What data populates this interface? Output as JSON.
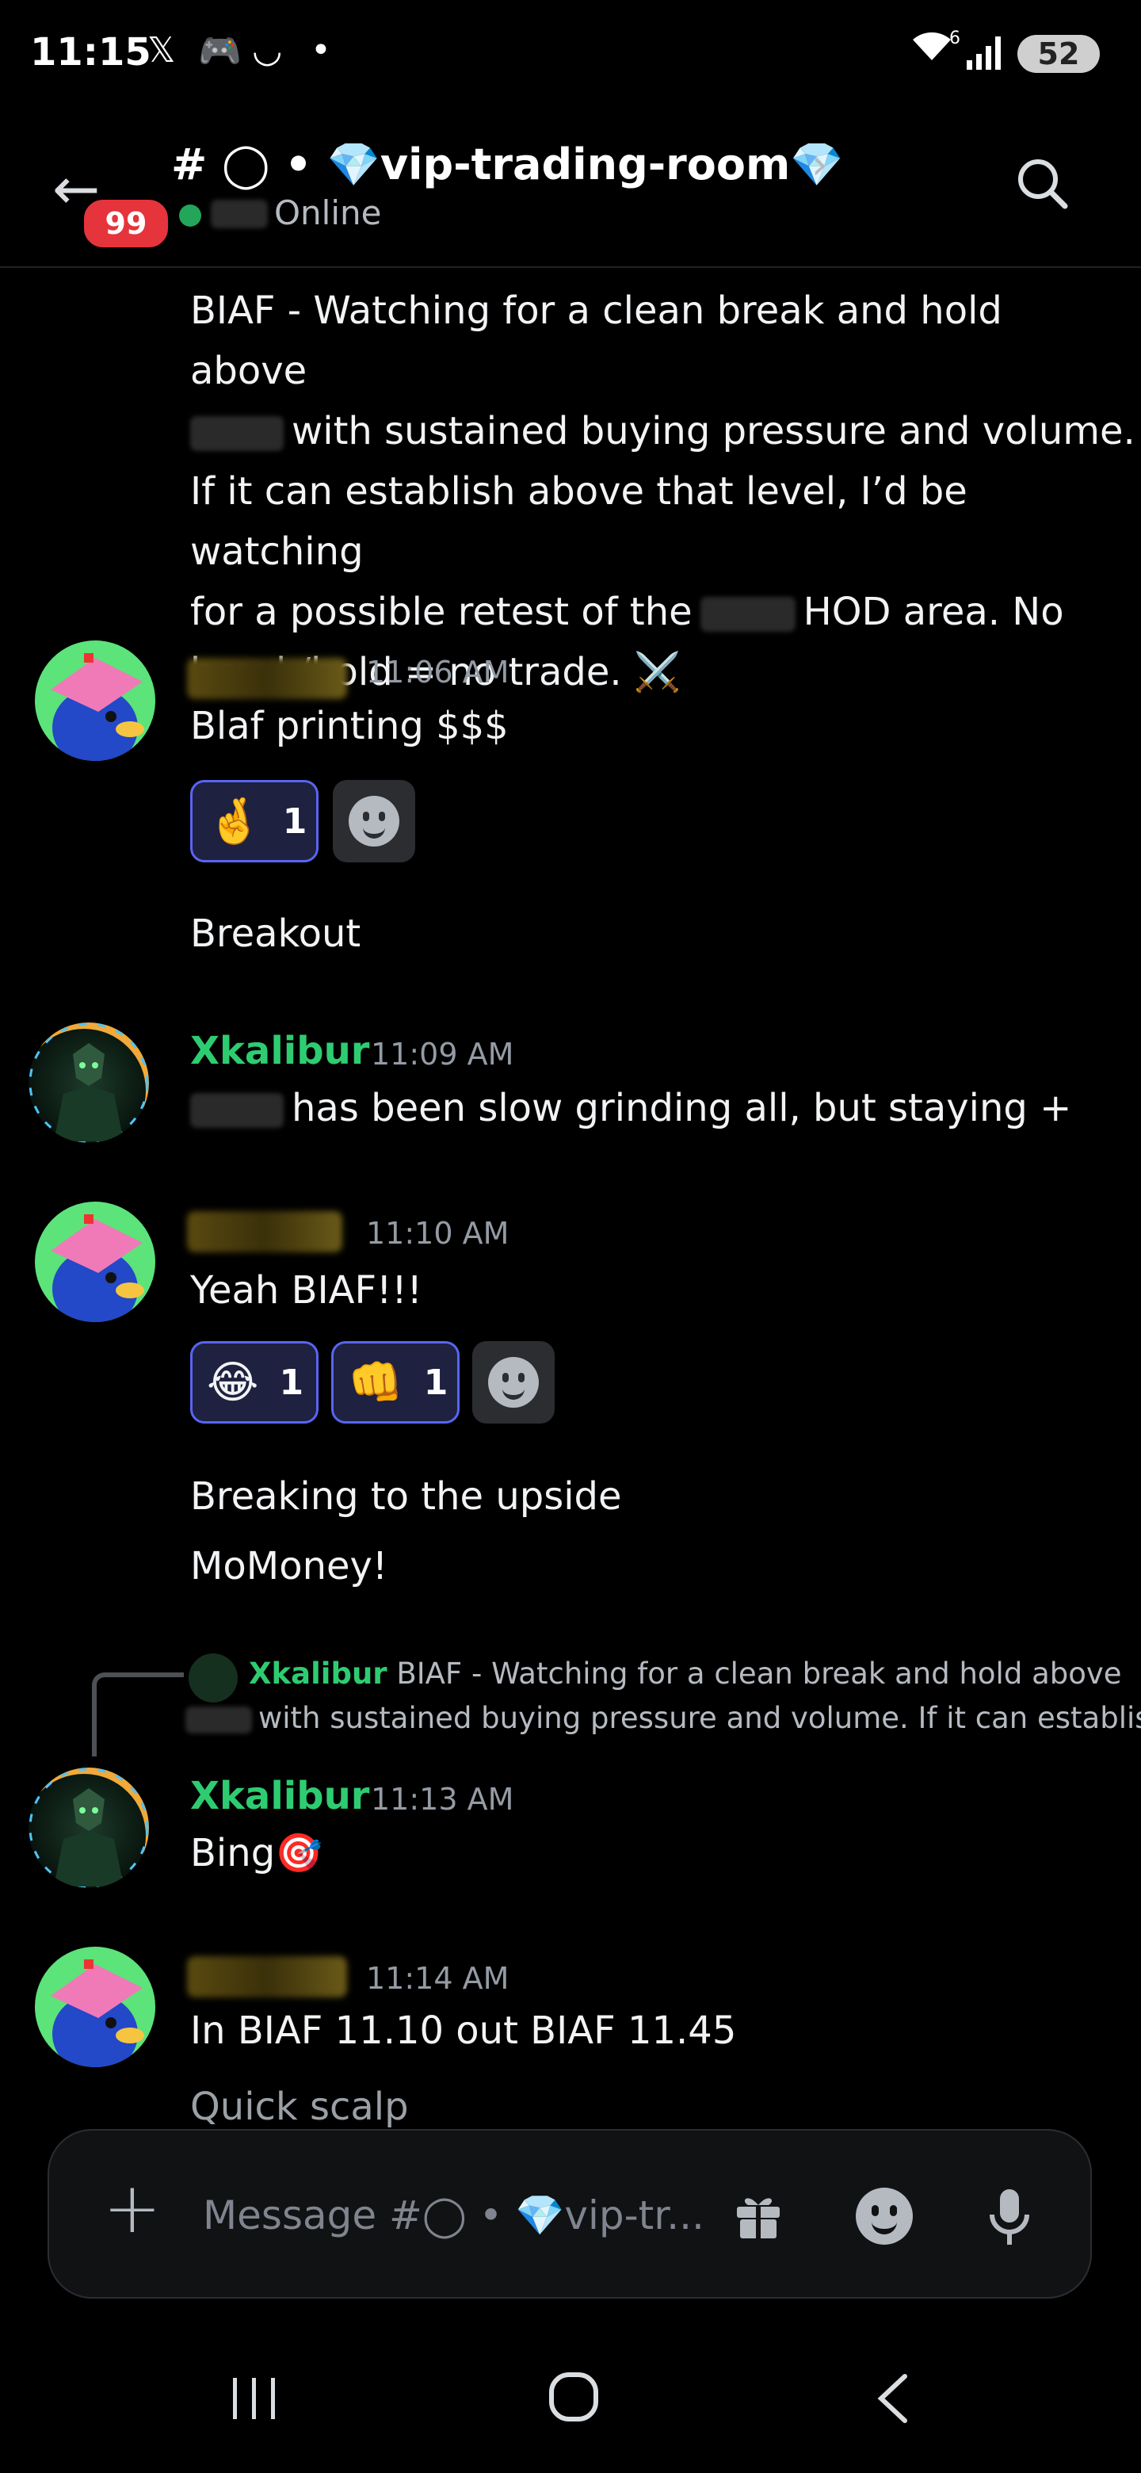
{
  "status_bar": {
    "time": "11:15",
    "icons": [
      "x-logo-icon",
      "discord-icon",
      "smile-status-icon",
      "dot-icon"
    ],
    "wifi_superscript": "6",
    "battery": "52"
  },
  "header": {
    "unread_count": "99",
    "channel_name": "# ◯ • 💎vip-trading-room💎",
    "status": "Online"
  },
  "messages": [
    {
      "id": "m0",
      "lines": [
        "BIAF - Watching for a clean break and hold above",
        "with sustained buying pressure and volume.",
        "If it can establish above that level, I’d be watching",
        "for a possible retest of the",
        "HOD area. No",
        "break/hold = no trade. ⚔️"
      ]
    },
    {
      "id": "m1",
      "time": "11:06 AM",
      "text": "Blaf printing $$$",
      "reactions": [
        {
          "emoji": "🤞",
          "count": "1"
        }
      ],
      "followup": "Breakout"
    },
    {
      "id": "m2",
      "author": "Xkalibur",
      "time": "11:09 AM",
      "text": "has been slow grinding all, but staying +"
    },
    {
      "id": "m3",
      "time": "11:10 AM",
      "text": "Yeah BIAF!!!",
      "reactions": [
        {
          "emoji": "😂",
          "count": "1"
        },
        {
          "emoji": "👊",
          "count": "1"
        }
      ],
      "followups": [
        "Breaking to the upside",
        "MoMoney!"
      ]
    },
    {
      "id": "m4",
      "reply": {
        "author": "Xkalibur",
        "line1": "BIAF - Watching for a clean break and hold above",
        "line2": "with sustained buying pressure and volume. If it can establish"
      },
      "author": "Xkalibur",
      "time": "11:13 AM",
      "text": "Bing🎯"
    },
    {
      "id": "m5",
      "time": "11:14 AM",
      "text": "In BIAF 11.10 out BIAF 11.45",
      "followup": "Quick scalp"
    }
  ],
  "composer": {
    "placeholder": "Message #◯ • 💎vip-tr..."
  },
  "colors": {
    "background": "#000000",
    "accent": "#5865f2",
    "username_green": "#2ecc71",
    "badge_red": "#e5343b",
    "online_green": "#23a55a"
  }
}
